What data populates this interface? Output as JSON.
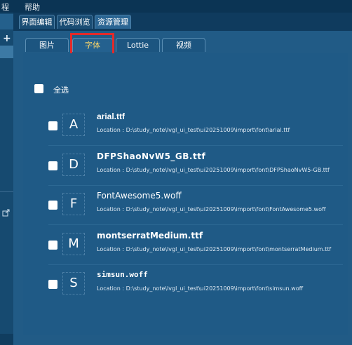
{
  "menu": {
    "items": [
      "程",
      "帮助"
    ]
  },
  "top_tabs": [
    {
      "label": "界面编辑",
      "active": false
    },
    {
      "label": "代码浏览",
      "active": false
    },
    {
      "label": "资源管理",
      "active": true
    }
  ],
  "sub_tabs": [
    {
      "label": "图片",
      "active": false
    },
    {
      "label": "字体",
      "active": true
    },
    {
      "label": "Lottie",
      "active": false
    },
    {
      "label": "视频",
      "active": false
    }
  ],
  "select_all": {
    "label": "全选",
    "checked": false
  },
  "fonts": [
    {
      "preview": "A",
      "name": "arial.ttf",
      "location": "Location : D:\\study_note\\lvgl_ui_test\\ui20251009\\import\\font\\arial.ttf",
      "checked": false
    },
    {
      "preview": "D",
      "name": "DFPShaoNvW5_GB.ttf",
      "location": "Location : D:\\study_note\\lvgl_ui_test\\ui20251009\\import\\font\\DFPShaoNvW5-GB.ttf",
      "checked": false
    },
    {
      "preview": "F",
      "name": "FontAwesome5.woff",
      "location": "Location : D:\\study_note\\lvgl_ui_test\\ui20251009\\import\\font\\FontAwesome5.woff",
      "checked": false
    },
    {
      "preview": "M",
      "name": "montserratMedium.ttf",
      "location": "Location : D:\\study_note\\lvgl_ui_test\\ui20251009\\import\\font\\montserratMedium.ttf",
      "checked": false
    },
    {
      "preview": "S",
      "name": "simsun.woff",
      "location": "Location : D:\\study_note\\lvgl_ui_test\\ui20251009\\import\\font\\simsun.woff",
      "checked": false
    }
  ],
  "left_rail": {
    "add_icon": "plus-icon",
    "link_icon": "external-link-icon"
  },
  "colors": {
    "background": "#1d4f76",
    "active_tab_text": "#f6d36b",
    "highlight_box": "#e32a2a"
  }
}
